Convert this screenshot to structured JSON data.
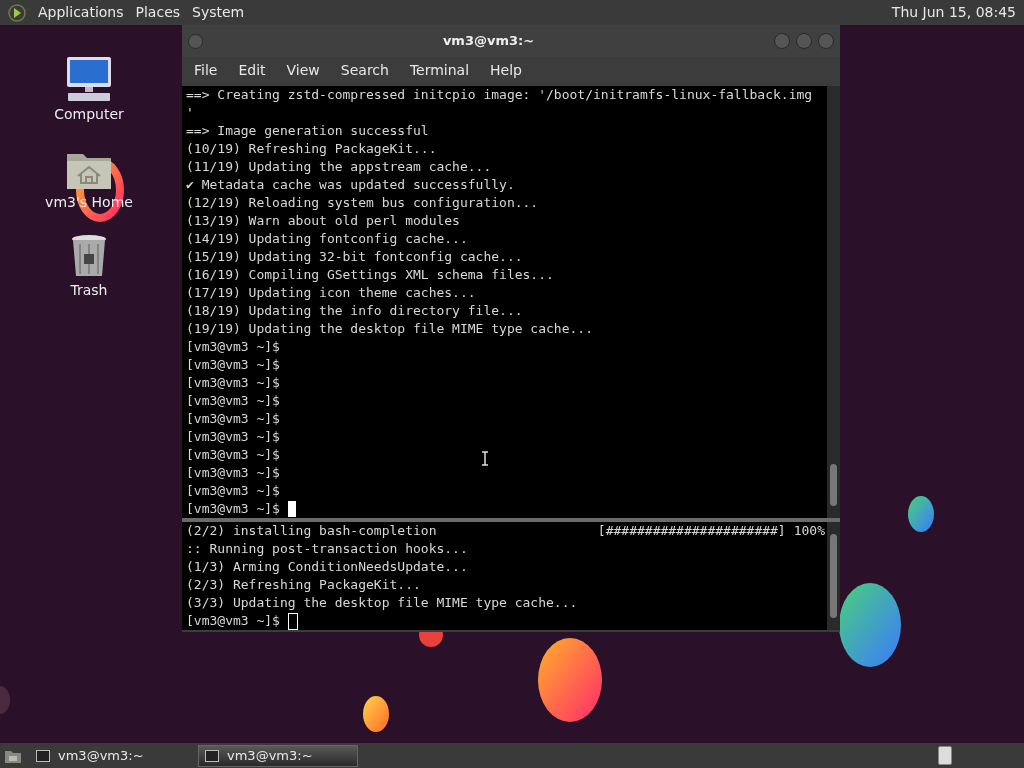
{
  "top_panel": {
    "menus": [
      "Applications",
      "Places",
      "System"
    ],
    "clock": "Thu Jun 15, 08:45"
  },
  "desktop_icons": [
    {
      "kind": "computer",
      "label": "Computer"
    },
    {
      "kind": "home",
      "label": "vm3's Home"
    },
    {
      "kind": "trash",
      "label": "Trash"
    }
  ],
  "window": {
    "title": "vm3@vm3:~",
    "menu": [
      "File",
      "Edit",
      "View",
      "Search",
      "Terminal",
      "Help"
    ],
    "panes": [
      {
        "lines": [
          "==> Creating zstd-compressed initcpio image: '/boot/initramfs-linux-fallback.img",
          "'",
          "==> Image generation successful",
          "(10/19) Refreshing PackageKit...",
          "(11/19) Updating the appstream cache...",
          "✔ Metadata cache was updated successfully.",
          "(12/19) Reloading system bus configuration...",
          "(13/19) Warn about old perl modules",
          "(14/19) Updating fontconfig cache...",
          "(15/19) Updating 32-bit fontconfig cache...",
          "(16/19) Compiling GSettings XML schema files...",
          "(17/19) Updating icon theme caches...",
          "(18/19) Updating the info directory file...",
          "(19/19) Updating the desktop file MIME type cache...",
          "[vm3@vm3 ~]$",
          "[vm3@vm3 ~]$",
          "[vm3@vm3 ~]$",
          "[vm3@vm3 ~]$",
          "[vm3@vm3 ~]$",
          "[vm3@vm3 ~]$",
          "[vm3@vm3 ~]$",
          "[vm3@vm3 ~]$",
          "[vm3@vm3 ~]$"
        ],
        "prompt": "[vm3@vm3 ~]$",
        "focused": true
      },
      {
        "header": {
          "text": "(2/2) installing bash-completion",
          "bar": "[######################]",
          "percent": "100%"
        },
        "lines": [
          ":: Running post-transaction hooks...",
          "(1/3) Arming ConditionNeedsUpdate...",
          "(2/3) Refreshing PackageKit...",
          "(3/3) Updating the desktop file MIME type cache..."
        ],
        "prompt": "[vm3@vm3 ~]$",
        "focused": false
      }
    ]
  },
  "taskbar": {
    "tasks": [
      {
        "label": "vm3@vm3:~",
        "selected": false
      },
      {
        "label": "vm3@vm3:~",
        "selected": true
      }
    ]
  }
}
